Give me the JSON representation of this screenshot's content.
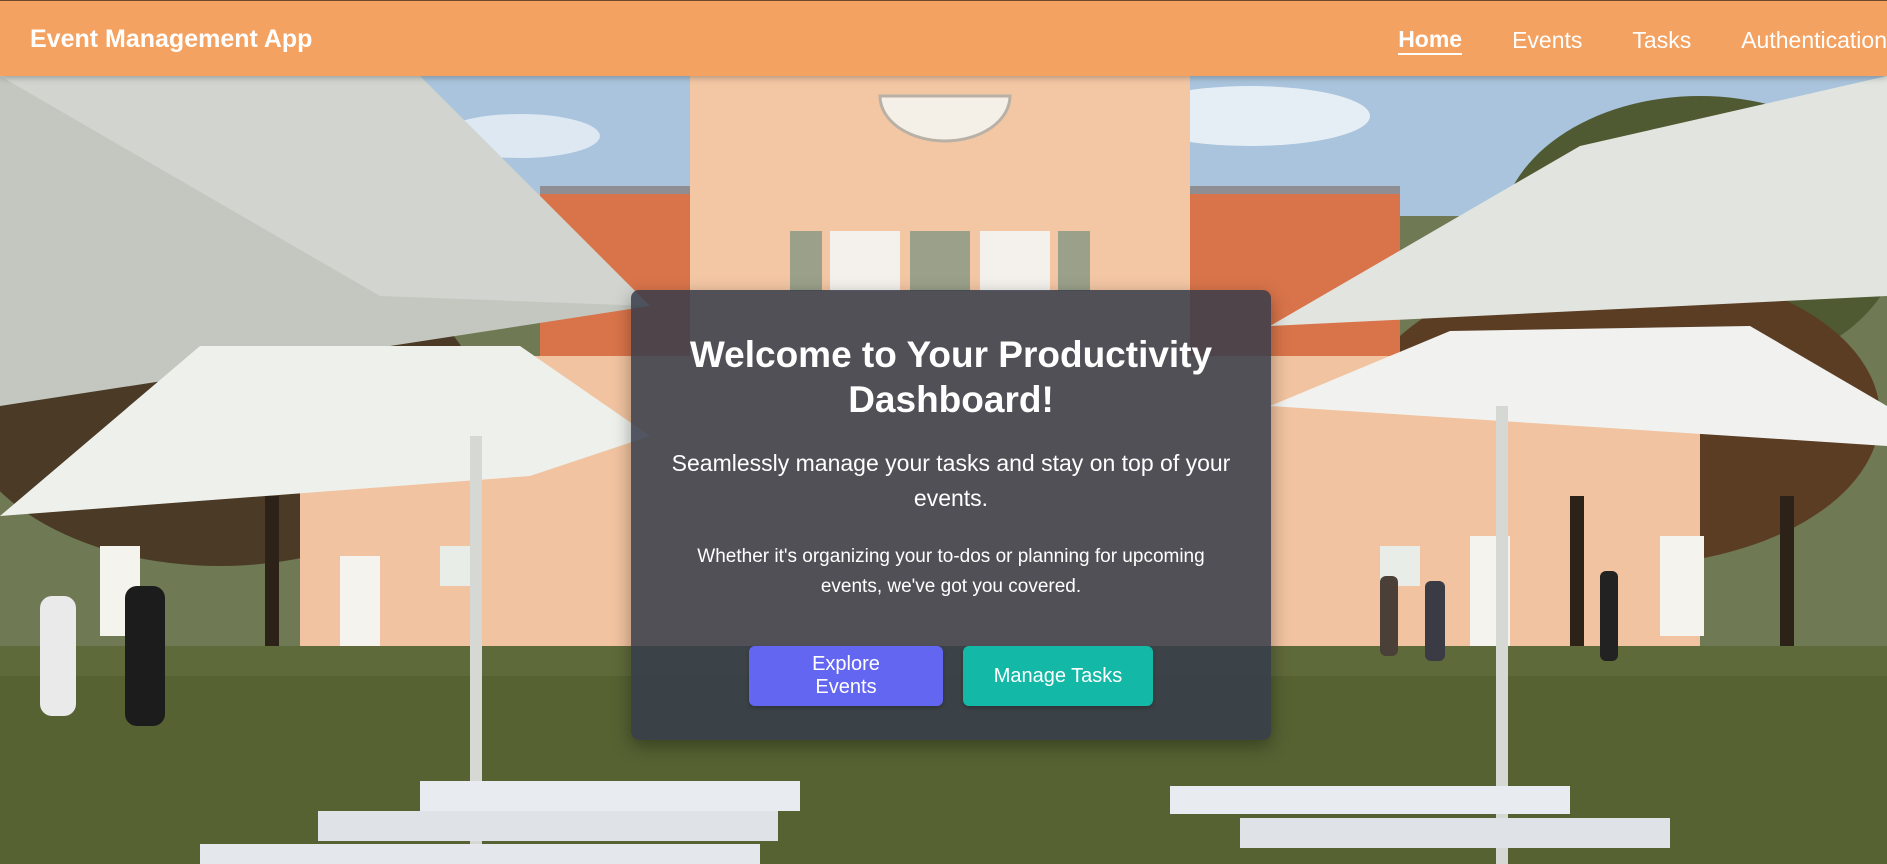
{
  "navbar": {
    "brand": "Event Management App",
    "links": [
      {
        "label": "Home",
        "active": true
      },
      {
        "label": "Events",
        "active": false
      },
      {
        "label": "Tasks",
        "active": false
      },
      {
        "label": "Authentication",
        "active": false
      }
    ]
  },
  "hero": {
    "title": "Welcome to Your Productivity Dashboard!",
    "lead": "Seamlessly manage your tasks and stay on top of your events.",
    "sub": "Whether it's organizing your to-dos or planning for upcoming events, we've got you covered.",
    "buttons": {
      "explore_label": "Explore Events",
      "manage_label": "Manage Tasks"
    }
  },
  "colors": {
    "navbar_bg": "#f4a261",
    "primary_button": "#6366f1",
    "secondary_button": "#14b8a6",
    "card_bg": "rgba(55,60,75,0.86)"
  },
  "background": {
    "image_description_icon": "wedding-venue-photo"
  }
}
